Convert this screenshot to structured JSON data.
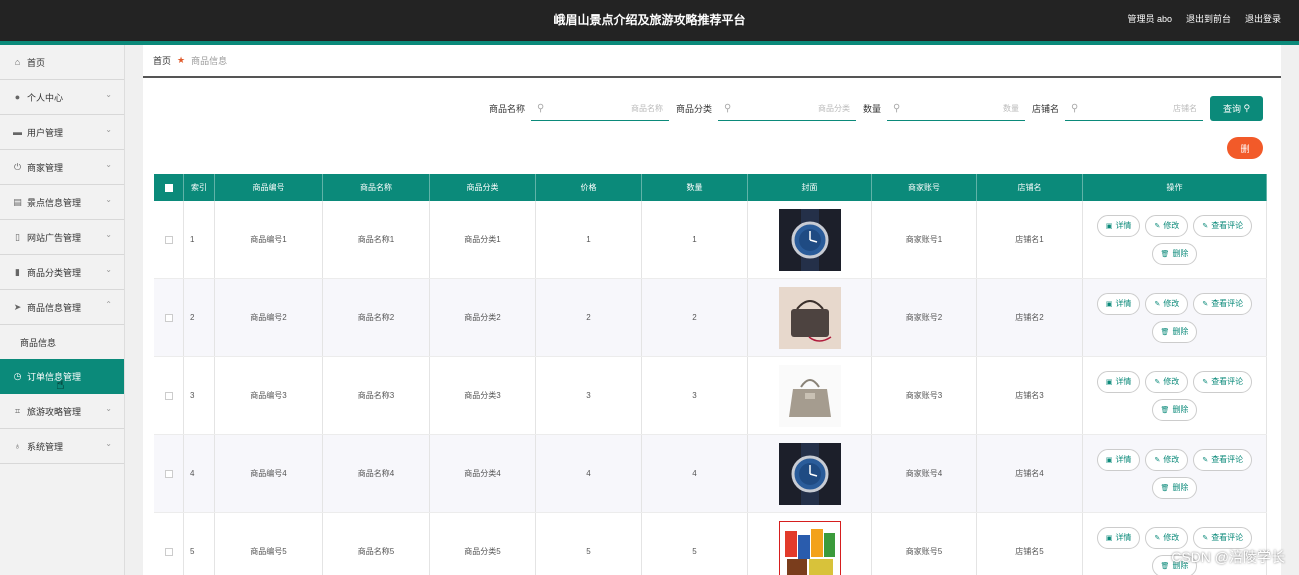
{
  "header": {
    "title": "峨眉山景点介绍及旅游攻略推荐平台",
    "user": "管理员 abo",
    "back": "退出到前台",
    "logout": "退出登录"
  },
  "sidebar": {
    "items": [
      {
        "label": "首页",
        "icon": "home-icon"
      },
      {
        "label": "个人中心",
        "icon": "user-icon"
      },
      {
        "label": "用户管理",
        "icon": "users-icon"
      },
      {
        "label": "商家管理",
        "icon": "power-icon"
      },
      {
        "label": "景点信息管理",
        "icon": "document-icon"
      },
      {
        "label": "网站广告管理",
        "icon": "mobile-icon"
      },
      {
        "label": "商品分类管理",
        "icon": "bar-chart-icon"
      },
      {
        "label": "商品信息管理",
        "icon": "send-icon"
      }
    ],
    "sub_item": "商品信息",
    "active_item": "订单信息管理",
    "after": [
      {
        "label": "旅游攻略管理",
        "icon": "crop-icon"
      },
      {
        "label": "系统管理",
        "icon": "mic-icon"
      }
    ]
  },
  "breadcrumb": {
    "home": "首页",
    "current": "商品信息"
  },
  "search": {
    "fields": [
      {
        "label": "商品名称",
        "placeholder": "商品名称"
      },
      {
        "label": "商品分类",
        "placeholder": "商品分类"
      },
      {
        "label": "数量",
        "placeholder": "数量"
      },
      {
        "label": "店铺名",
        "placeholder": "店铺名"
      }
    ],
    "query_button": "查询",
    "delete_button": "删"
  },
  "table": {
    "headers": [
      "索引",
      "商品编号",
      "商品名称",
      "商品分类",
      "价格",
      "数量",
      "封面",
      "商家账号",
      "店铺名",
      "操作"
    ],
    "rows": [
      {
        "idx": "1",
        "code": "商品编号1",
        "name": "商品名称1",
        "cat": "商品分类1",
        "price": "1",
        "qty": "1",
        "acct": "商家账号1",
        "shop": "店铺名1",
        "cover": "watch"
      },
      {
        "idx": "2",
        "code": "商品编号2",
        "name": "商品名称2",
        "cat": "商品分类2",
        "price": "2",
        "qty": "2",
        "acct": "商家账号2",
        "shop": "店铺名2",
        "cover": "handbag"
      },
      {
        "idx": "3",
        "code": "商品编号3",
        "name": "商品名称3",
        "cat": "商品分类3",
        "price": "3",
        "qty": "3",
        "acct": "商家账号3",
        "shop": "店铺名3",
        "cover": "tote-bag"
      },
      {
        "idx": "4",
        "code": "商品编号4",
        "name": "商品名称4",
        "cat": "商品分类4",
        "price": "4",
        "qty": "4",
        "acct": "商家账号4",
        "shop": "店铺名4",
        "cover": "watch"
      },
      {
        "idx": "5",
        "code": "商品编号5",
        "name": "商品名称5",
        "cat": "商品分类5",
        "price": "5",
        "qty": "5",
        "acct": "商家账号5",
        "shop": "店铺名5",
        "cover": "snacks"
      }
    ],
    "ops": {
      "detail": "详情",
      "edit": "修改",
      "comments": "查看评论",
      "delete": "删除"
    }
  },
  "watermark": "CSDN @涪陵学长",
  "colors": {
    "primary": "#0b8a7a",
    "danger": "#f25a29",
    "header": "#232323"
  }
}
